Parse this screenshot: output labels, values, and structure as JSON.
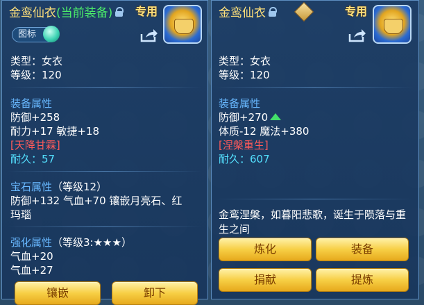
{
  "left": {
    "name": "金鸾仙衣",
    "current_tag": "(当前装备)",
    "special": "专用",
    "icon_tag": "图标",
    "type_line": "类型：女衣",
    "level_line": "等级：120",
    "equip_attr_title": "装备属性",
    "defense": "防御+258",
    "stamina_agility": "耐力+17 敏捷+18",
    "special_effect": "[天降甘霖]",
    "durability": "耐久：57",
    "gem_title": "宝石属性",
    "gem_level": "（等级12）",
    "gem_line1": "防御+132 气血+70 镶嵌月亮石、红",
    "gem_line2": "玛瑙",
    "enhance_title": "强化属性",
    "enhance_level": "（等级3:★★★）",
    "enhance_hp1": "气血+20",
    "enhance_hp2": "气血+27",
    "btn_inlay": "镶嵌",
    "btn_unequip": "卸下"
  },
  "right": {
    "name": "金鸾仙衣",
    "special": "专用",
    "type_line": "类型：女衣",
    "level_line": "等级：120",
    "equip_attr_title": "装备属性",
    "defense": "防御+270",
    "con_magic": "体质-12 魔法+380",
    "special_effect": "[涅槃重生]",
    "durability": "耐久：607",
    "description": "金鸾涅槃，如暮阳悲歌，诞生于陨落与重生之间",
    "btn_refine": "炼化",
    "btn_equip": "装备",
    "btn_donate": "捐献",
    "btn_purify": "提炼"
  },
  "colors": {
    "title": "#ffe07a",
    "current": "#4cf06a",
    "section": "#68b8ff",
    "effect": "#ff5a5a",
    "durability": "#54e1ff"
  },
  "icons": [
    "lock-icon",
    "rank-icon",
    "share-icon",
    "item-icon",
    "green-up-arrow-icon"
  ]
}
